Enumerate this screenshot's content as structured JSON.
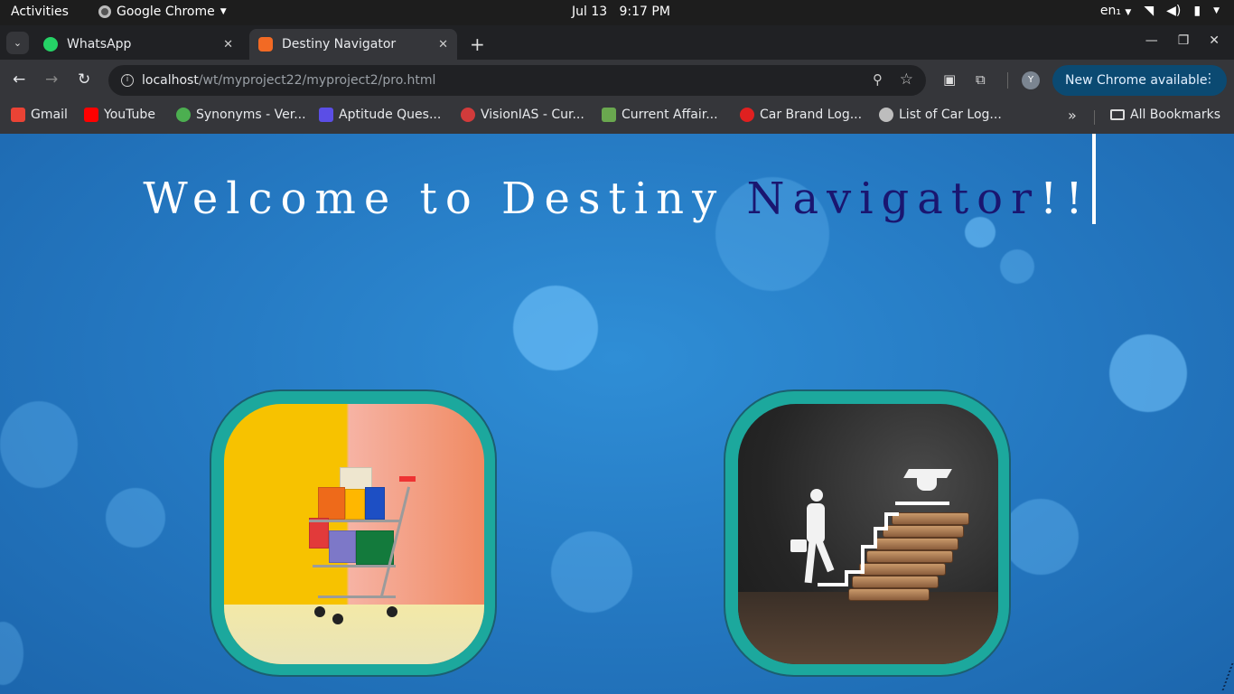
{
  "system_bar": {
    "activities": "Activities",
    "app_name": "Google Chrome",
    "date": "Jul 13",
    "time": "9:17 PM",
    "language": "en₁"
  },
  "tabs": [
    {
      "title": "WhatsApp",
      "icon": "whatsapp-icon"
    },
    {
      "title": "Destiny Navigator",
      "icon": "xampp-icon",
      "active": true
    }
  ],
  "address_bar": {
    "host": "localhost",
    "path": "/wt/myproject22/myproject2/pro.html"
  },
  "update_button": {
    "label": "New Chrome available"
  },
  "profile": {
    "initial": "Y"
  },
  "bookmarks": [
    {
      "label": "Gmail",
      "color": "#ea4335"
    },
    {
      "label": "YouTube",
      "color": "#ff0000"
    },
    {
      "label": "Synonyms - Ver...",
      "color": "#4caf50"
    },
    {
      "label": "Aptitude Ques...",
      "color": "#5b4ee6"
    },
    {
      "label": "VisionIAS - Cur...",
      "color": "#d23b3b"
    },
    {
      "label": "Current Affair...",
      "color": "#6aa84f"
    },
    {
      "label": "Car Brand Log...",
      "color": "#e02020"
    },
    {
      "label": "List of Car Log...",
      "color": "#bdbdbd"
    }
  ],
  "all_bookmarks": "All Bookmarks",
  "page": {
    "heading_main": "Welcome to Destiny ",
    "heading_accent": "Navigator",
    "heading_suffix": "!!",
    "accent_color": "#1a1670",
    "cards": [
      {
        "name": "shopping",
        "image": "shopping-cart-with-boxes"
      },
      {
        "name": "education",
        "image": "person-climbing-book-stairs-to-graduation-cap"
      }
    ]
  }
}
